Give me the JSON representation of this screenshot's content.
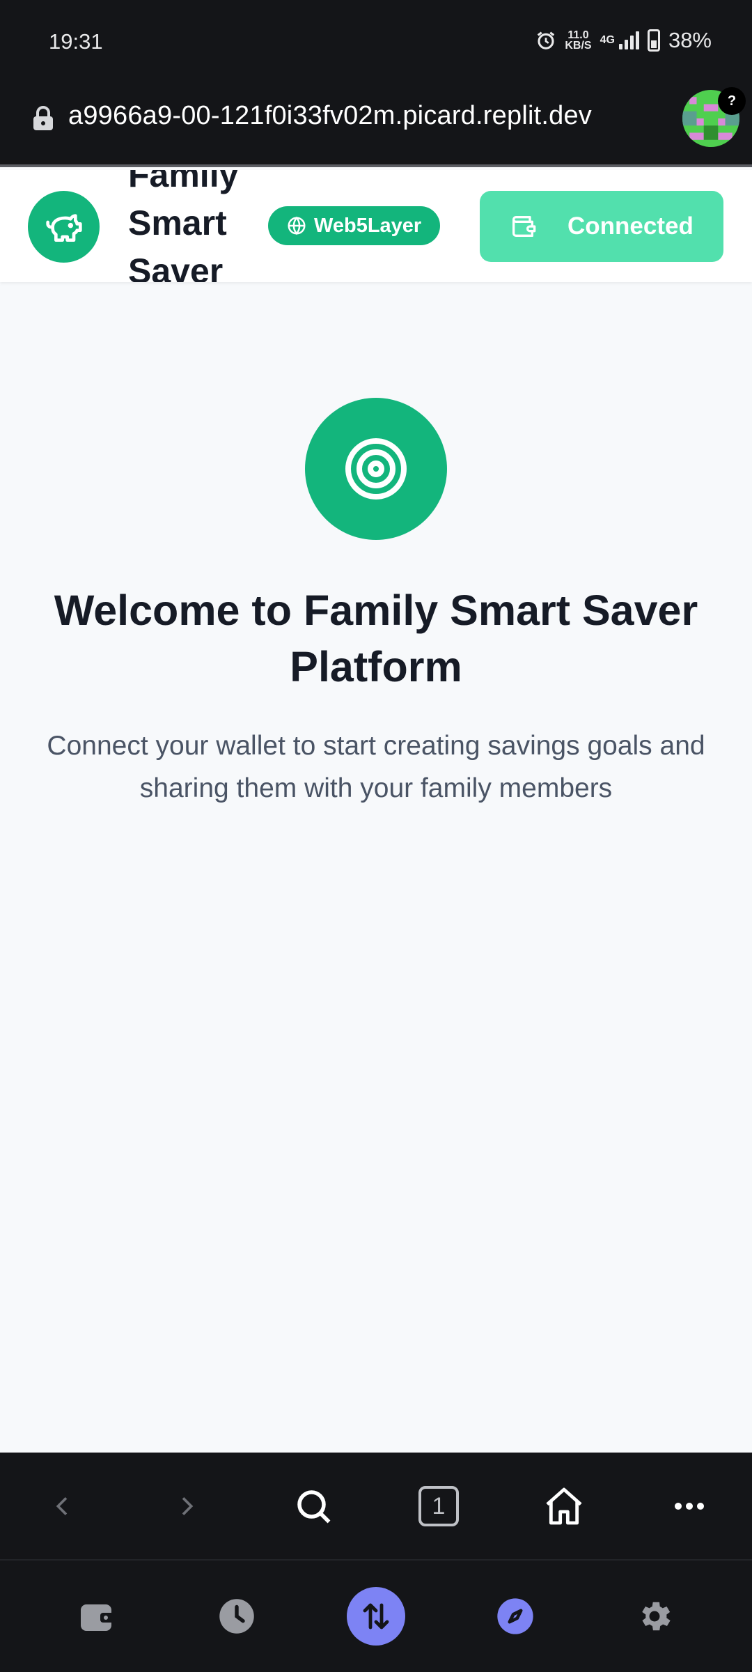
{
  "status_bar": {
    "time": "19:31",
    "net_speed_value": "11.0",
    "net_speed_unit": "KB/S",
    "network_type": "4G",
    "battery": "38%"
  },
  "browser": {
    "url": "a9966a9-00-121f0i33fv02m.picard.replit.dev",
    "avatar_badge": "?",
    "tab_count": "1"
  },
  "header": {
    "brand": "Family Smart Saver",
    "network_badge": "Web5Layer",
    "wallet_button": "Connected"
  },
  "main": {
    "title": "Welcome to Family Smart Saver Platform",
    "subtitle": "Connect your wallet to start creating savings goals and sharing them with your family members"
  },
  "colors": {
    "brand_green": "#13b57c",
    "connected_green": "#52e0ad",
    "nav_active": "#7d83f4"
  },
  "icons": {
    "logo": "piggy-bank-icon",
    "badge": "globe-icon",
    "button": "wallet-icon",
    "hero": "target-icon"
  }
}
